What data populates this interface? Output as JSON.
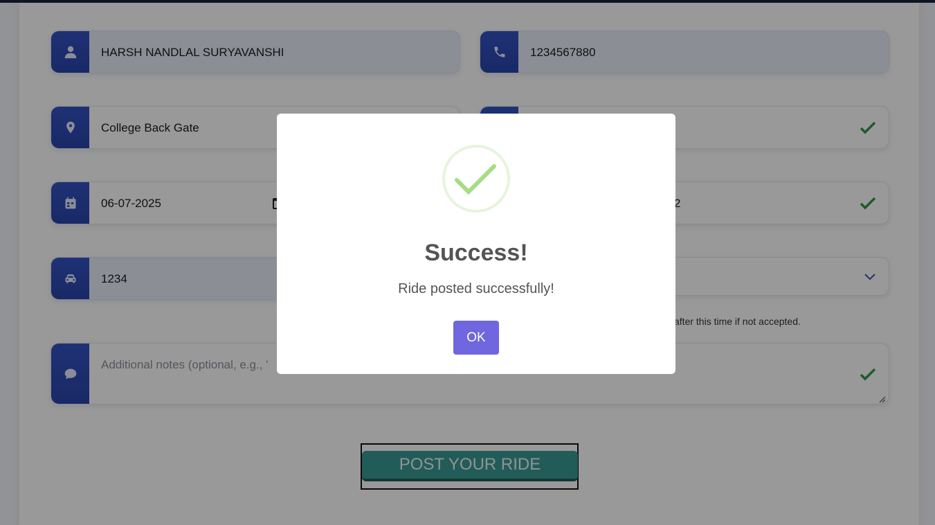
{
  "form": {
    "name": "HARSH NANDLAL SURYAVANSHI",
    "phone": "1234567880",
    "pickup": "College Back Gate",
    "date": "06-07-2025",
    "time_partial": "2",
    "vehicle_number": "1234",
    "expiry_hint_partial": "after this time if not accepted.",
    "notes_placeholder_partial": "Additional notes (optional, e.g., '",
    "post_button": "POST YOUR RIDE"
  },
  "modal": {
    "title": "Success!",
    "message": "Ride posted successfully!",
    "ok": "OK"
  },
  "colors": {
    "icon_bg": "#3453c4",
    "check": "#2e9a45",
    "post_button": "#3a9a93",
    "ok_button": "#7066e0",
    "success_ring": "#a5dc86"
  }
}
